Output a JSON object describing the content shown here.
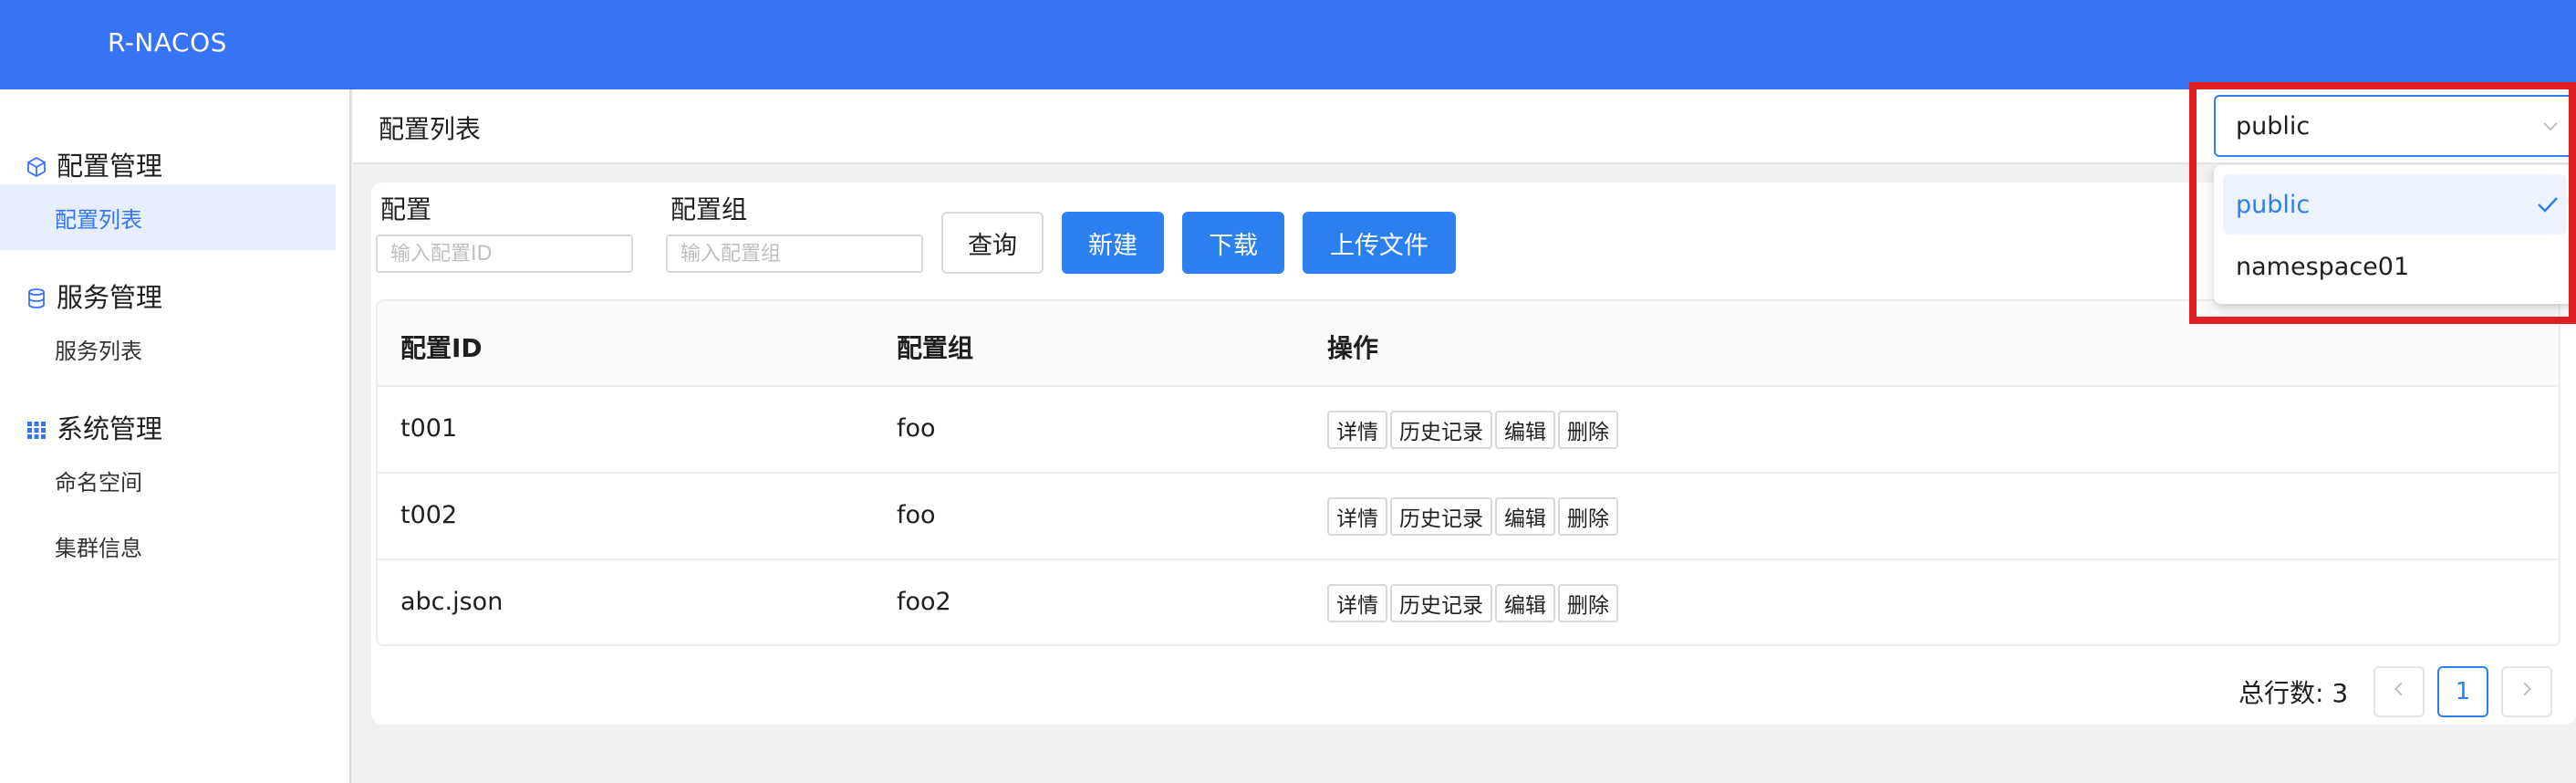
{
  "app": {
    "brand": "R-NACOS"
  },
  "sidebar": {
    "groups": [
      {
        "label": "配置管理",
        "icon": "cube-icon",
        "items": [
          {
            "label": "配置列表",
            "active": true
          }
        ]
      },
      {
        "label": "服务管理",
        "icon": "database-icon",
        "items": [
          {
            "label": "服务列表",
            "active": false
          }
        ]
      },
      {
        "label": "系统管理",
        "icon": "grid-icon",
        "items": [
          {
            "label": "命名空间",
            "active": false
          },
          {
            "label": "集群信息",
            "active": false
          }
        ]
      }
    ]
  },
  "page": {
    "title": "配置列表"
  },
  "filters": {
    "config": {
      "label": "配置",
      "placeholder": "输入配置ID",
      "value": ""
    },
    "group": {
      "label": "配置组",
      "placeholder": "输入配置组",
      "value": ""
    }
  },
  "buttons": {
    "query": "查询",
    "create": "新建",
    "download": "下载",
    "upload": "上传文件"
  },
  "table": {
    "columns": [
      "配置ID",
      "配置组",
      "操作"
    ],
    "rows": [
      {
        "id": "t001",
        "group": "foo"
      },
      {
        "id": "t002",
        "group": "foo"
      },
      {
        "id": "abc.json",
        "group": "foo2"
      }
    ],
    "row_actions": [
      "详情",
      "历史记录",
      "编辑",
      "删除"
    ]
  },
  "pagination": {
    "total_text": "总行数: 3",
    "current_page": "1",
    "prev_icon": "chevron-left-icon",
    "next_icon": "chevron-right-icon"
  },
  "namespace": {
    "selected": "public",
    "options": [
      {
        "label": "public",
        "selected": true
      },
      {
        "label": "namespace01",
        "selected": false
      }
    ]
  },
  "colors": {
    "header": "#3673f5",
    "primary": "#2b7ff0",
    "highlight": "#e02020"
  }
}
